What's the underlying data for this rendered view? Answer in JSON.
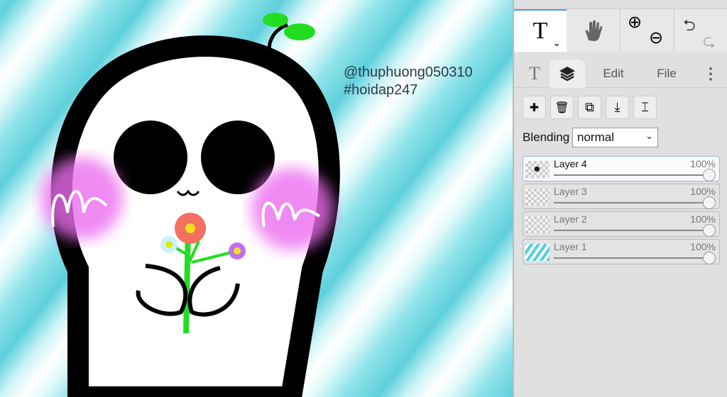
{
  "canvas": {
    "watermark_1": "@thuphuong050310",
    "watermark_2": "#hoidap247"
  },
  "toolbar": {
    "text_tool": "T",
    "dropdown": "⌄",
    "hand": "hand-icon",
    "zoom_in": "⊕",
    "zoom_out": "⊖",
    "undo": "⮌",
    "redo": "⮎"
  },
  "tabs": {
    "text": "T",
    "edit": "Edit",
    "file": "File",
    "more": "⋮"
  },
  "actions": {
    "add": "✚",
    "delete": "🗑",
    "duplicate": "⧉",
    "merge": "⤓",
    "rename": "⌶"
  },
  "blending": {
    "label": "Blending",
    "value": "normal"
  },
  "layers": [
    {
      "name": "Layer 4",
      "opacity": "100%",
      "value": 100
    },
    {
      "name": "Layer 3",
      "opacity": "100%",
      "value": 100
    },
    {
      "name": "Layer 2",
      "opacity": "100%",
      "value": 100
    },
    {
      "name": "Layer 1",
      "opacity": "100%",
      "value": 100
    }
  ]
}
